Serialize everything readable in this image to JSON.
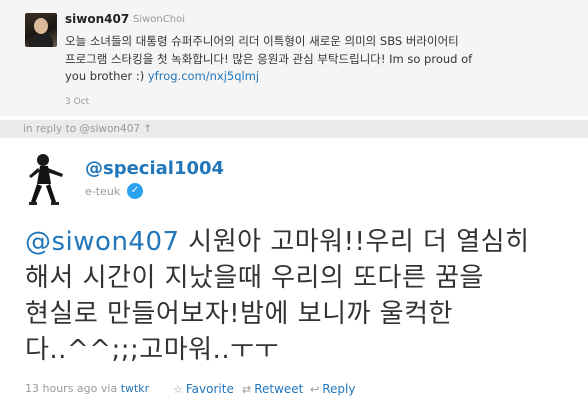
{
  "quoted_tweet": {
    "screen_name": "siwon407",
    "real_name": "SiwonChoi",
    "text_line1": "오늘 소녀들의 대통령 슈퍼주니어의 리더 이특형이 새로운 의미의 SBS 버라이어티",
    "text_line2": "프로그램 스타킹을 첫 녹화합니다! 많은 응원과 관심 부탁드립니다! Im so proud of",
    "text_line3_prefix": "you brother :) ",
    "link": "yfrog.com/nxj5qlmj",
    "time": "3 Oct"
  },
  "reply_bar": {
    "label": "in reply to @siwon407 ↑"
  },
  "tweet": {
    "screen_name": "@special1004",
    "real_name": "e-teuk",
    "verified": true,
    "mention": "@siwon407",
    "text_line1_rest": " 시원아 고마워!!우리 더 열심히",
    "text_line2": "해서 시간이 지났을때 우리의 또다른 꿈을",
    "text_line3": "현실로 만들어보자!밤에 보니까 울컥한",
    "text_line4": "다..^^;;;고마워..ㅜㅜ"
  },
  "meta": {
    "time": "13 hours ago",
    "via_prefix": "via",
    "via_app": "twtkr"
  },
  "actions": {
    "favorite": "Favorite",
    "retweet": "Retweet",
    "reply": "Reply"
  },
  "colors": {
    "link": "#2277bb",
    "muted": "#999999",
    "quoted_bg": "#f5f5f5",
    "reply_bar_bg": "#ebebeb",
    "verified": "#2aa2ef"
  },
  "icons": {
    "favorite": "star-icon",
    "retweet": "retweet-icon",
    "reply": "reply-arrow-icon",
    "verified": "verified-check-icon"
  }
}
